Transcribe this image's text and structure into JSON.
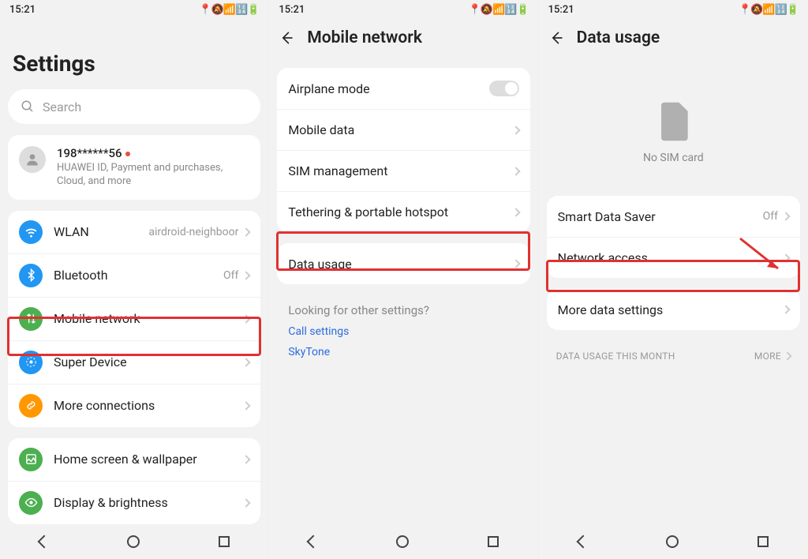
{
  "statusbar": {
    "time": "15:21"
  },
  "phone1": {
    "title": "Settings",
    "search_placeholder": "Search",
    "account": {
      "name": "198******56",
      "sub": "HUAWEI ID, Payment and purchases, Cloud, and more"
    },
    "items": {
      "wlan": {
        "label": "WLAN",
        "value": "airdroid-neighboor"
      },
      "bluetooth": {
        "label": "Bluetooth",
        "value": "Off"
      },
      "mobile_network": {
        "label": "Mobile network"
      },
      "super_device": {
        "label": "Super Device"
      },
      "more_connections": {
        "label": "More connections"
      },
      "home_wallpaper": {
        "label": "Home screen & wallpaper"
      },
      "display_brightness": {
        "label": "Display & brightness"
      }
    }
  },
  "phone2": {
    "title": "Mobile network",
    "items": {
      "airplane": {
        "label": "Airplane mode"
      },
      "mobile_data": {
        "label": "Mobile data"
      },
      "sim": {
        "label": "SIM management"
      },
      "tethering": {
        "label": "Tethering & portable hotspot"
      },
      "data_usage": {
        "label": "Data usage"
      }
    },
    "other": {
      "heading": "Looking for other settings?",
      "call": "Call settings",
      "skytone": "SkyTone"
    }
  },
  "phone3": {
    "title": "Data usage",
    "no_sim": "No SIM card",
    "items": {
      "smart_saver": {
        "label": "Smart Data Saver",
        "value": "Off"
      },
      "network_access": {
        "label": "Network access"
      },
      "more_data": {
        "label": "More data settings"
      }
    },
    "section": {
      "label": "DATA USAGE THIS MONTH",
      "more": "MORE"
    }
  }
}
